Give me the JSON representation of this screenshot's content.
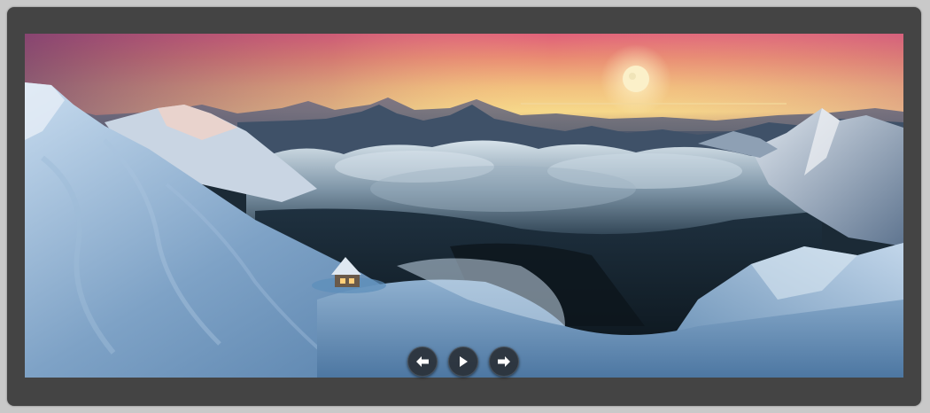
{
  "slider": {
    "slide": {
      "image": "panorama-snowy-mountain-peak-sunset-moon-cloud-sea-hut"
    },
    "controls": {
      "prev_icon": "arrow-left-icon",
      "play_icon": "play-icon",
      "next_icon": "arrow-right-icon"
    },
    "colors": {
      "frame": "#444444",
      "page": "#c9c9c9",
      "button": "#2a2d33",
      "icon": "#ffffff"
    }
  }
}
